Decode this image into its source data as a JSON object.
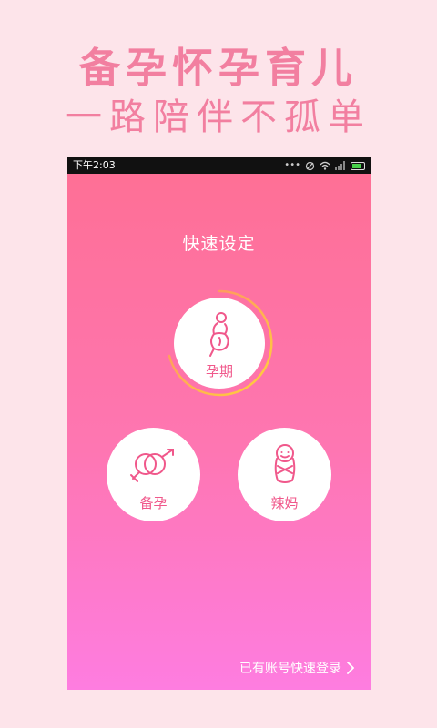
{
  "promo": {
    "title": "备孕怀孕育儿",
    "subtitle": "一路陪伴不孤单"
  },
  "status_bar": {
    "time": "下午2:03",
    "icons": [
      "dots-icon",
      "no-sim-icon",
      "wifi-icon",
      "signal-icon",
      "battery-icon"
    ]
  },
  "screen": {
    "title": "快速设定",
    "options": {
      "pregnancy": {
        "label": "孕期",
        "icon": "pregnant-woman-icon",
        "selected": true
      },
      "trying": {
        "label": "备孕",
        "icon": "gender-symbols-icon"
      },
      "mom": {
        "label": "辣妈",
        "icon": "swaddled-baby-icon"
      }
    },
    "quick_login": "已有账号快速登录"
  },
  "colors": {
    "background": "#fde4ea",
    "promo_text": "#f27fa0",
    "gradient_top": "#fe6f94",
    "gradient_bottom": "#fe7de0",
    "accent_pink": "#f0588b",
    "ring_start": "#ff8a6a",
    "ring_end": "#ffd23a"
  }
}
